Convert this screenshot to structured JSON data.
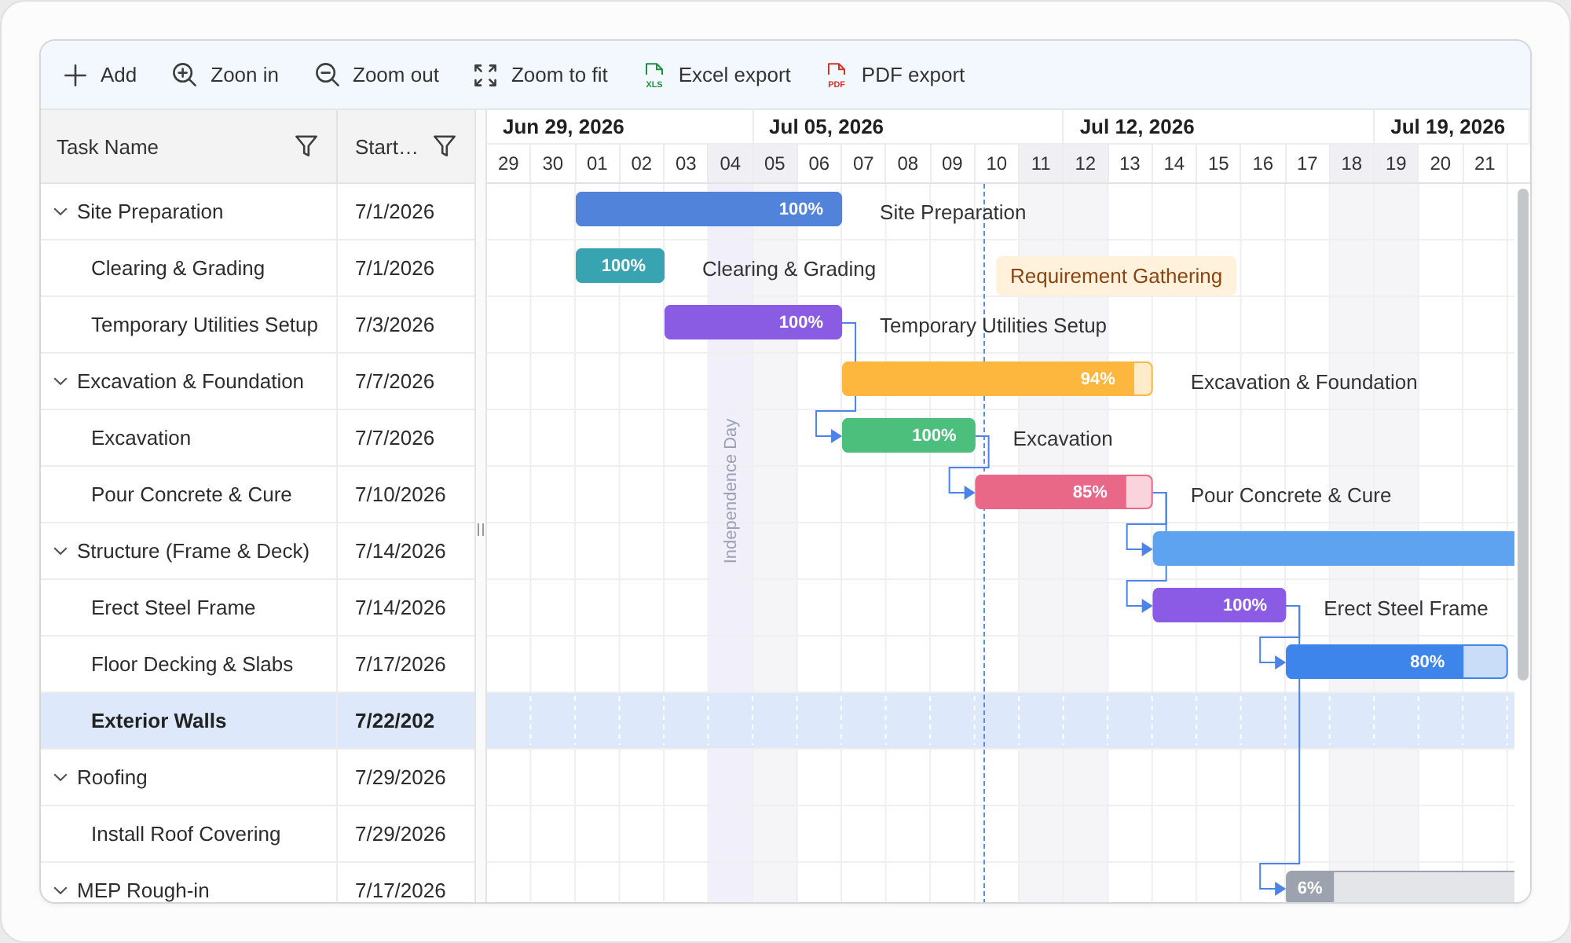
{
  "toolbar": [
    {
      "kind": "add",
      "label": "Add"
    },
    {
      "kind": "zoom_in",
      "label": "Zoon in"
    },
    {
      "kind": "zoom_out",
      "label": "Zoom out"
    },
    {
      "kind": "fit",
      "label": "Zoom to fit"
    },
    {
      "kind": "excel",
      "label": "Excel export",
      "icon_text": "XLS"
    },
    {
      "kind": "pdf",
      "label": "PDF export",
      "icon_text": "PDF"
    }
  ],
  "columns": [
    {
      "label": "Task Name"
    },
    {
      "label": "Start…"
    }
  ],
  "tasks": [
    {
      "name": "Site Preparation",
      "start": "7/1/2026",
      "expanded": true,
      "selected": false,
      "bar": {
        "color": "#5283db",
        "level": 1,
        "percent": "100%",
        "label": "Site Preparation",
        "has_predecessor": false
      },
      "children": [
        {
          "name": "Clearing & Grading",
          "start": "7/1/2026",
          "selected": false,
          "bar": {
            "color": "#38a3b1",
            "level": 1,
            "percent": "100%",
            "label": "Clearing & Grading",
            "has_predecessor": false
          }
        },
        {
          "name": "Temporary Utilities Setup",
          "start": "7/3/2026",
          "selected": false,
          "bar": {
            "color": "#8a5be3",
            "level": 1,
            "percent": "100%",
            "label": "Temporary Utilities Setup",
            "has_predecessor": false
          }
        }
      ]
    },
    {
      "name": "Excavation & Foundation",
      "start": "7/7/2026",
      "expanded": true,
      "selected": false,
      "bar": {
        "color": "#fdb73f",
        "level": 0.94,
        "percent": "94%",
        "label": "Excavation & Foundation",
        "has_predecessor": false
      },
      "children": [
        {
          "name": "Excavation",
          "start": "7/7/2026",
          "selected": false,
          "bar": {
            "color": "#4bbf7b",
            "level": 1,
            "percent": "100%",
            "label": "Excavation",
            "has_predecessor": true
          }
        },
        {
          "name": "Pour Concrete & Cure",
          "start": "7/10/2026",
          "selected": false,
          "bar": {
            "color": "#e96787",
            "level": 0.85,
            "percent": "85%",
            "label": "Pour Concrete & Cure",
            "has_predecessor": true
          }
        }
      ]
    },
    {
      "name": "Structure (Frame & Deck)",
      "start": "7/14/2026",
      "expanded": true,
      "selected": false,
      "bar": {
        "color": "#5ea3ef",
        "has_predecessor": true
      },
      "children": [
        {
          "name": "Erect Steel Frame",
          "start": "7/14/2026",
          "selected": false,
          "bar": {
            "color": "#8b5be6",
            "level": 1,
            "percent": "100%",
            "label": "Erect Steel Frame",
            "has_predecessor": true
          }
        },
        {
          "name": "Floor Decking & Slabs",
          "start": "7/17/2026",
          "selected": false,
          "bar": {
            "color": "#3d85eb",
            "level": 0.8,
            "percent": "80%",
            "has_predecessor": true
          }
        },
        {
          "name": "Exterior Walls",
          "start": "7/22/202",
          "selected": true
        }
      ]
    },
    {
      "name": "Roofing",
      "start": "7/29/2026",
      "expanded": true,
      "selected": false,
      "children": [
        {
          "name": "Install Roof Covering",
          "start": "7/29/2026",
          "selected": false
        }
      ]
    },
    {
      "name": "MEP Rough-in",
      "start": "7/17/2026",
      "expanded": true,
      "selected": false,
      "bar": {
        "color": "#9ca3af",
        "level": 0.06,
        "percent": "6%",
        "has_predecessor": true
      }
    }
  ],
  "timeline": {
    "weeks": [
      {
        "label": "Jun 29, 2026"
      },
      {
        "label": "Jul 05, 2026"
      },
      {
        "label": "Jul 12, 2026"
      },
      {
        "label": "Jul 19, 2026"
      }
    ],
    "days": [
      {
        "label": "29",
        "weekend": false
      },
      {
        "label": "30",
        "weekend": false
      },
      {
        "label": "01",
        "weekend": false
      },
      {
        "label": "02",
        "weekend": false
      },
      {
        "label": "03",
        "weekend": false
      },
      {
        "label": "04",
        "weekend": true
      },
      {
        "label": "05",
        "weekend": true
      },
      {
        "label": "06",
        "weekend": false
      },
      {
        "label": "07",
        "weekend": false
      },
      {
        "label": "08",
        "weekend": false
      },
      {
        "label": "09",
        "weekend": false
      },
      {
        "label": "10",
        "weekend": false
      },
      {
        "label": "11",
        "weekend": true
      },
      {
        "label": "12",
        "weekend": true
      },
      {
        "label": "13",
        "weekend": false
      },
      {
        "label": "14",
        "weekend": false
      },
      {
        "label": "15",
        "weekend": false
      },
      {
        "label": "16",
        "weekend": false
      },
      {
        "label": "17",
        "weekend": false
      },
      {
        "label": "18",
        "weekend": true
      },
      {
        "label": "19",
        "weekend": true
      },
      {
        "label": "20",
        "weekend": false
      },
      {
        "label": "21",
        "weekend": false
      }
    ],
    "holidays": [
      {
        "label": "Independence Day"
      }
    ],
    "event_markers": [
      {
        "label": "Requirement Gathering"
      }
    ]
  }
}
